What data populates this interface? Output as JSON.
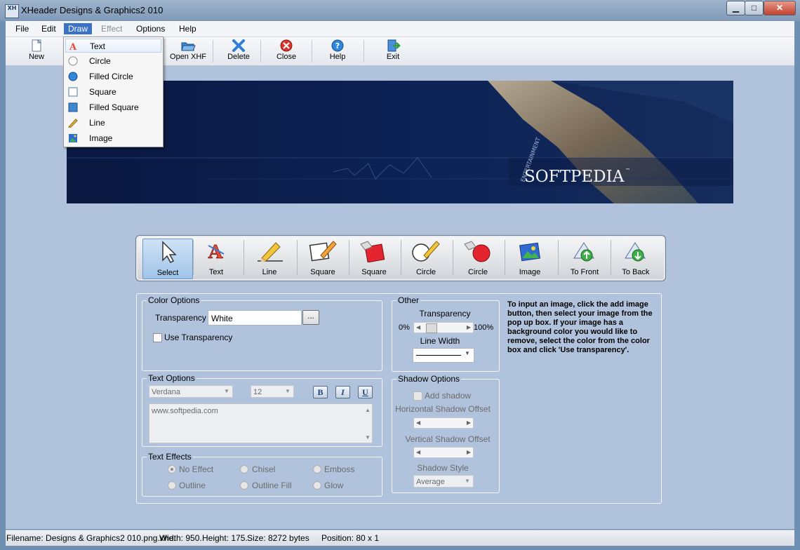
{
  "window": {
    "title": "XHeader Designs & Graphics2 010",
    "logo_text": "XH",
    "min_glyph": "▁",
    "max_glyph": "□",
    "close_glyph": "✕"
  },
  "menubar": {
    "items": [
      "File",
      "Edit",
      "Draw",
      "Effect",
      "Options",
      "Help"
    ]
  },
  "draw_menu": {
    "items": [
      {
        "label": "Text",
        "icon": "text-icon"
      },
      {
        "label": "Circle",
        "icon": "circle-icon"
      },
      {
        "label": "Filled Circle",
        "icon": "filled-circle-icon"
      },
      {
        "label": "Square",
        "icon": "square-icon"
      },
      {
        "label": "Filled Square",
        "icon": "filled-square-icon"
      },
      {
        "label": "Line",
        "icon": "line-icon"
      },
      {
        "label": "Image",
        "icon": "image-icon"
      }
    ]
  },
  "toolbar": {
    "new": "New",
    "open_xhf": "Open XHF",
    "delete": "Delete",
    "close": "Close",
    "help": "Help",
    "exit": "Exit"
  },
  "banner": {
    "brand": "SOFTPEDIA",
    "tm": "™",
    "vertical_text": "ENTERTAINMENT"
  },
  "draw_tools": {
    "items": [
      "Select",
      "Text",
      "Line",
      "Square",
      "Square",
      "Circle",
      "Circle",
      "Image",
      "To Front",
      "To Back"
    ]
  },
  "color_options": {
    "caption": "Color Options",
    "transparency_label": "Transparency",
    "transparency_value": "White",
    "browse_label": "...",
    "use_transparency": "Use Transparency"
  },
  "other": {
    "caption": "Other",
    "transparency_label": "Transparency",
    "min_label": "0%",
    "max_label": "100%",
    "line_width_label": "Line Width",
    "transparency_level": 0.1
  },
  "help_text": "To input an image, click the add image button, then select your image from the pop up box. If your image has a background color you would like to remove, select the color from the color box and click 'Use transparency'.",
  "text_options": {
    "caption": "Text Options",
    "font": "Verdana",
    "size": "12",
    "bold": "B",
    "italic": "I",
    "underline": "U",
    "text": "www.softpedia.com"
  },
  "text_effects": {
    "caption": "Text Effects",
    "options": [
      "No Effect",
      "Chisel",
      "Emboss",
      "Outline",
      "Outline Fill",
      "Glow"
    ],
    "selected": "No Effect"
  },
  "shadow_options": {
    "caption": "Shadow Options",
    "add_shadow": "Add shadow",
    "horizontal_label": "Horizontal Shadow Offset",
    "vertical_label": "Vertical Shadow Offset",
    "style_label": "Shadow Style",
    "style_value": "Average"
  },
  "statusbar": {
    "filename": "Filename: Designs & Graphics2 010.png.xhe.",
    "width": "Width: 950.",
    "height": "Height: 175.",
    "size": "Size: 8272 bytes",
    "position": "Position: 80 x 1"
  },
  "colors": {
    "client_bg": "#b1c3dc",
    "menu_highlight": "#3a73c6",
    "banner_bg": "#0b1a44"
  }
}
